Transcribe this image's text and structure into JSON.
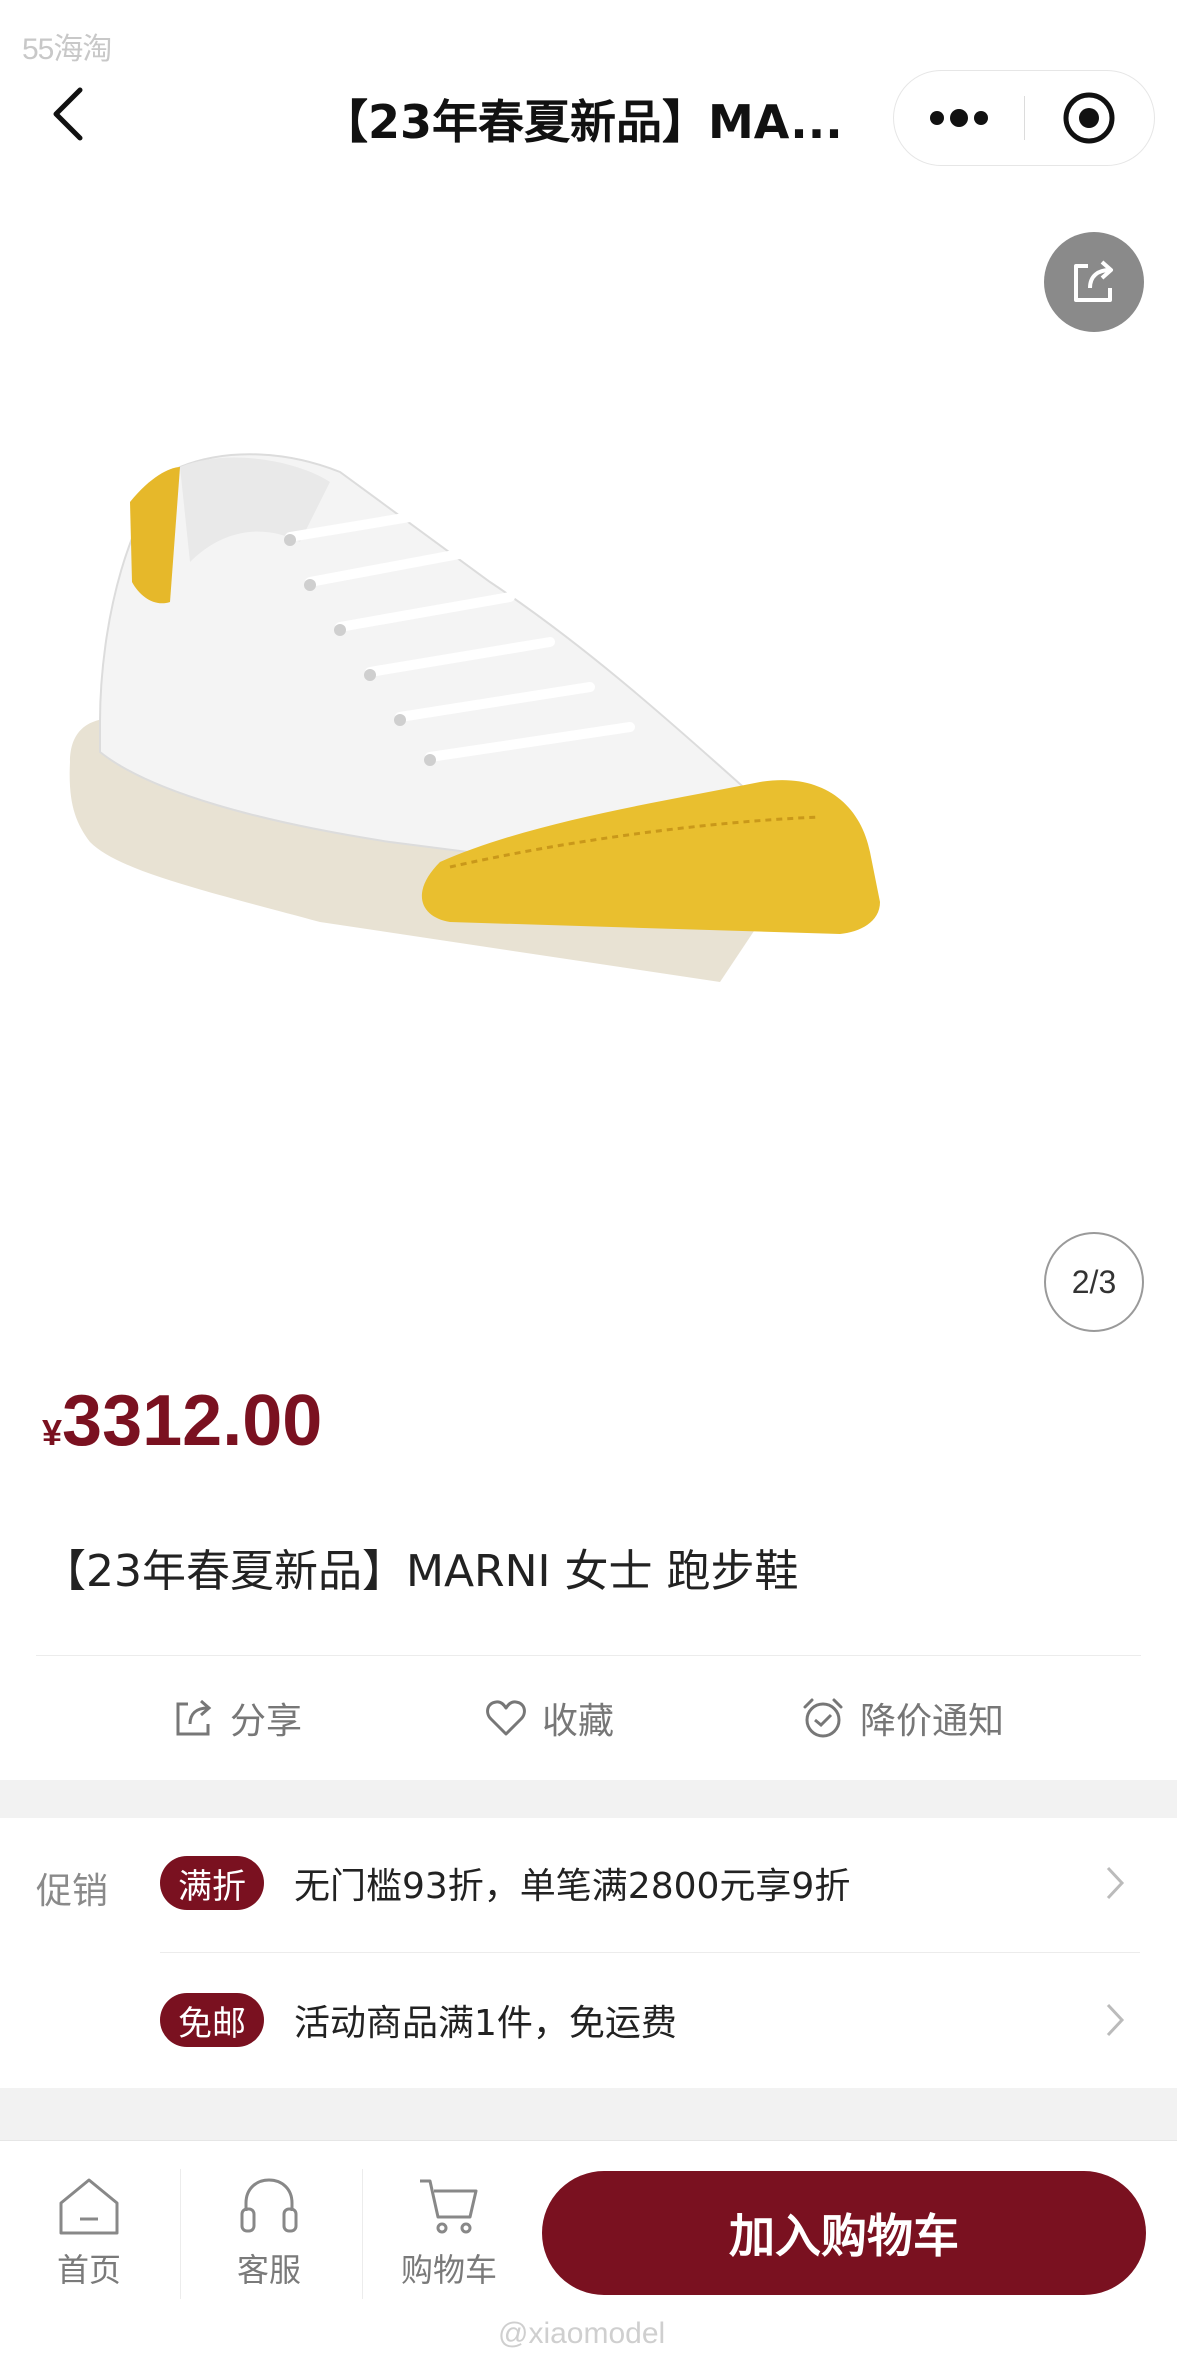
{
  "watermark_top": "55海淘",
  "nav": {
    "title": "【23年春夏新品】MA...",
    "icons": {
      "back": "chevron-left-icon",
      "more": "more-dots-icon",
      "target": "target-icon"
    }
  },
  "gallery": {
    "page_indicator": "2/3",
    "share_icon": "share-icon",
    "current_index": 2,
    "total": 3
  },
  "price": {
    "currency_symbol": "¥",
    "amount": "3312.00",
    "color": "#7a1120"
  },
  "product": {
    "title": "【23年春夏新品】MARNI 女士 跑步鞋"
  },
  "actions": [
    {
      "label": "分享",
      "icon": "share-icon"
    },
    {
      "label": "收藏",
      "icon": "heart-icon"
    },
    {
      "label": "降价通知",
      "icon": "alarm-clock-icon"
    }
  ],
  "promotions": {
    "label": "促销",
    "items": [
      {
        "badge": "满折",
        "text": "无门槛93折，单笔满2800元享9折"
      },
      {
        "badge": "免邮",
        "text": "活动商品满1件，免运费"
      }
    ]
  },
  "tabbar": {
    "tabs": [
      {
        "label": "首页",
        "icon": "home-icon"
      },
      {
        "label": "客服",
        "icon": "headset-icon"
      },
      {
        "label": "购物车",
        "icon": "cart-icon"
      }
    ],
    "add_to_cart": "加入购物车",
    "watermark": "@xiaomodel"
  }
}
